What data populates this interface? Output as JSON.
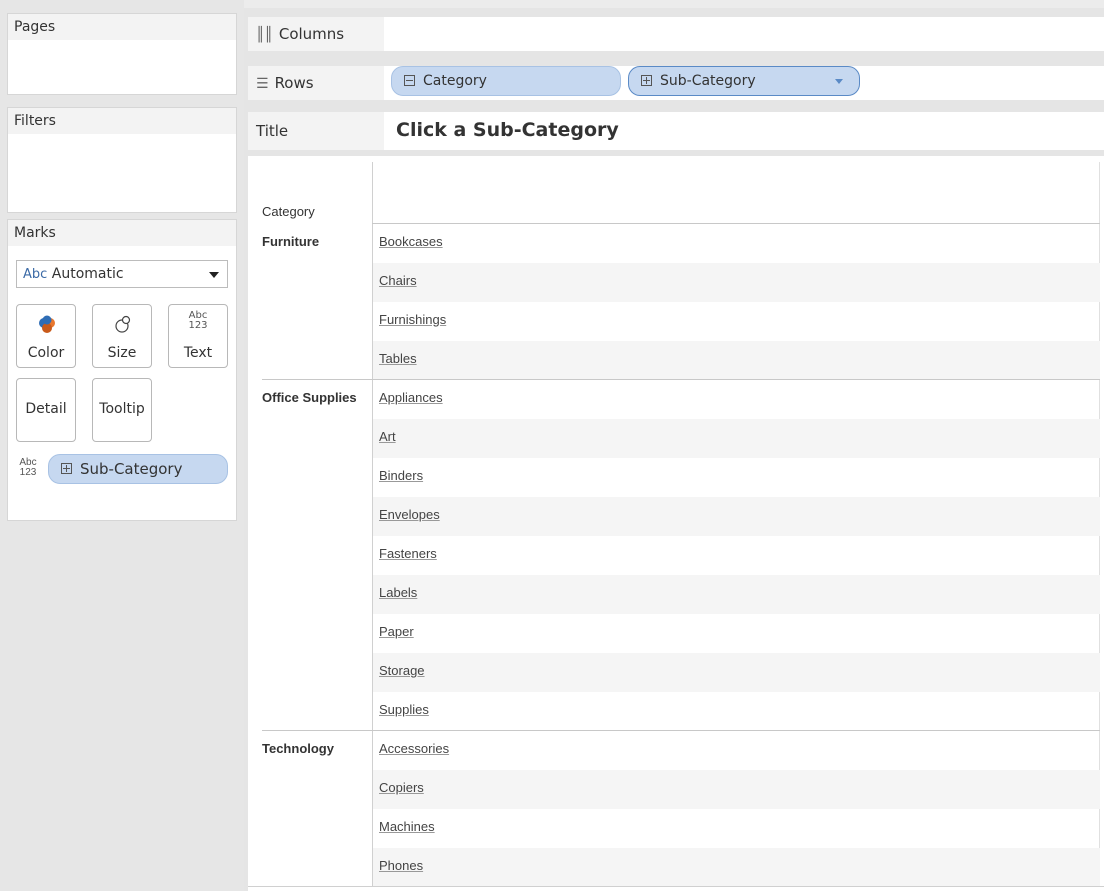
{
  "sidebar": {
    "pages_label": "Pages",
    "filters_label": "Filters",
    "marks_label": "Marks",
    "mark_type_prefix": "Abc",
    "mark_type": "Automatic",
    "buttons": {
      "color": "Color",
      "size": "Size",
      "text": "Text",
      "detail": "Detail",
      "tooltip": "Tooltip"
    },
    "text_icon_top": "Abc",
    "text_icon_bottom": "123",
    "mark_field": "Sub-Category"
  },
  "shelves": {
    "columns_label": "Columns",
    "rows_label": "Rows",
    "title_label": "Title",
    "rows_pills": [
      "Category",
      "Sub-Category"
    ],
    "title_text": "Click a Sub-Category"
  },
  "view": {
    "category_header": "Category",
    "groups": [
      {
        "category": "Furniture",
        "items": [
          "Bookcases",
          "Chairs",
          "Furnishings",
          "Tables"
        ]
      },
      {
        "category": "Office Supplies",
        "items": [
          "Appliances",
          "Art",
          "Binders",
          "Envelopes",
          "Fasteners",
          "Labels",
          "Paper",
          "Storage",
          "Supplies"
        ]
      },
      {
        "category": "Technology",
        "items": [
          "Accessories",
          "Copiers",
          "Machines",
          "Phones"
        ]
      }
    ]
  },
  "colors": {
    "pill_fill": "#c6d8f0",
    "pill_border": "#a8c2e4",
    "accent": "#3b6aa6"
  }
}
